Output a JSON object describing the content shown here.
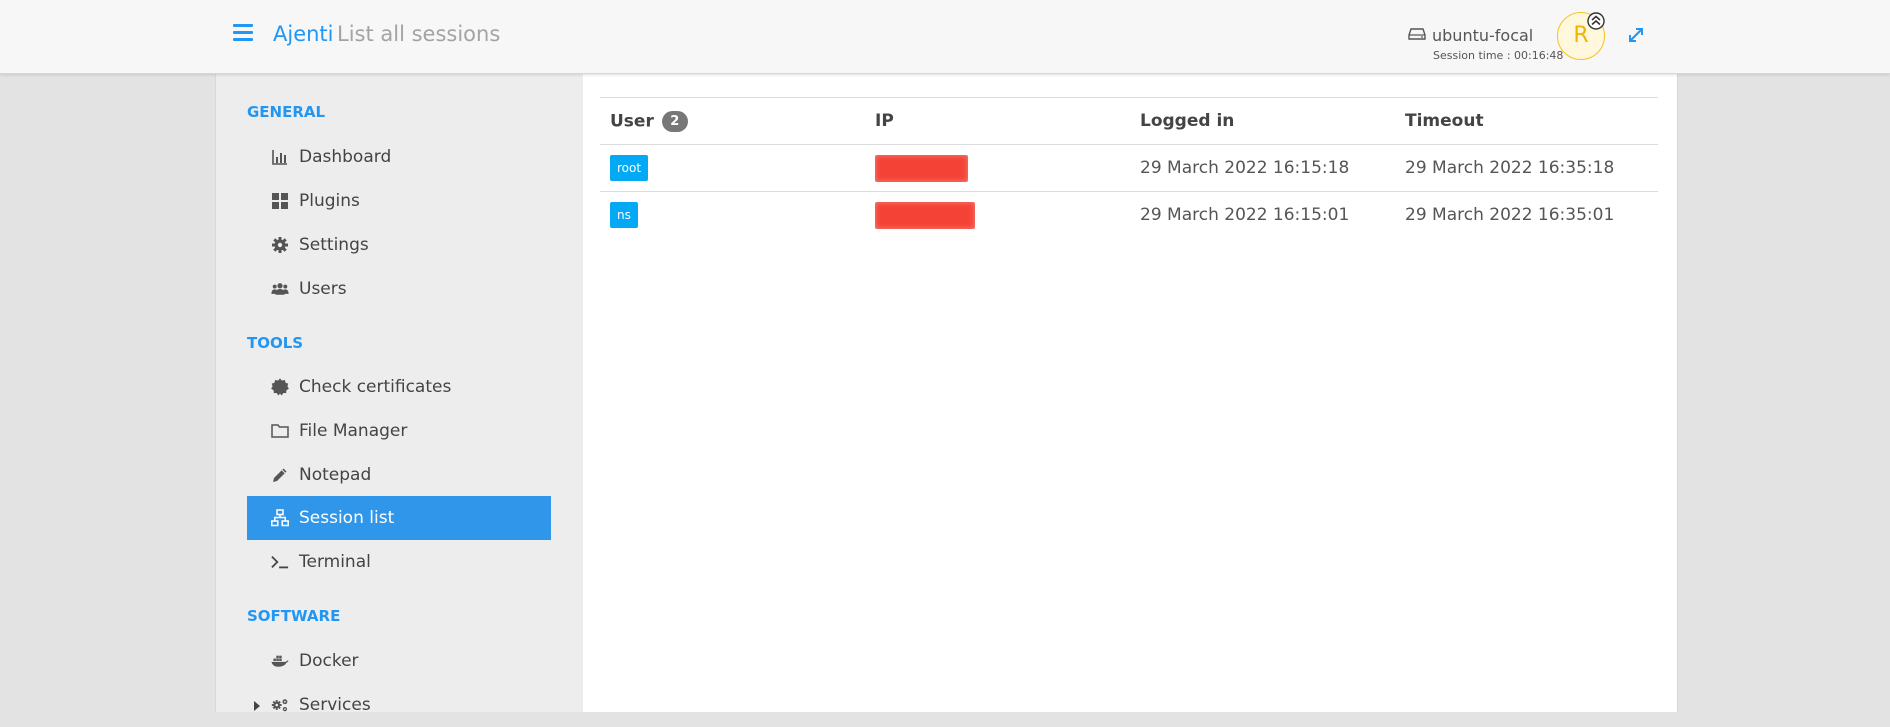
{
  "header": {
    "brand": "Ajenti",
    "page_title": "List all sessions",
    "host_name": "ubuntu-focal",
    "session_time": "Session time : 00:16:48",
    "avatar_letter": "R",
    "icons": {
      "menu": "hamburger-menu-icon",
      "host": "hard-drive-icon",
      "avatar_badge": "double-chevron-up-icon",
      "expand": "expand-arrows-icon"
    }
  },
  "sidebar": {
    "sections": [
      {
        "title": "GENERAL",
        "items": [
          {
            "label": "Dashboard",
            "icon": "bar-chart-icon"
          },
          {
            "label": "Plugins",
            "icon": "grid-icon"
          },
          {
            "label": "Settings",
            "icon": "gear-icon"
          },
          {
            "label": "Users",
            "icon": "users-icon"
          }
        ]
      },
      {
        "title": "TOOLS",
        "items": [
          {
            "label": "Check certificates",
            "icon": "certificate-icon"
          },
          {
            "label": "File Manager",
            "icon": "folder-icon"
          },
          {
            "label": "Notepad",
            "icon": "pencil-icon"
          },
          {
            "label": "Session list",
            "icon": "sitemap-icon",
            "active": true
          },
          {
            "label": "Terminal",
            "icon": "terminal-icon"
          }
        ]
      },
      {
        "title": "SOFTWARE",
        "items": [
          {
            "label": "Docker",
            "icon": "docker-icon"
          },
          {
            "label": "Services",
            "icon": "gears-icon"
          }
        ]
      }
    ]
  },
  "table": {
    "columns": [
      "User",
      "IP",
      "Logged in",
      "Timeout"
    ],
    "user_count": "2",
    "rows": [
      {
        "user": "root",
        "ip": "",
        "logged_in": "29 March 2022 16:15:18",
        "timeout": "29 March 2022 16:35:18"
      },
      {
        "user": "ns",
        "ip": "",
        "logged_in": "29 March 2022 16:15:01",
        "timeout": "29 March 2022 16:35:01"
      }
    ]
  },
  "colors": {
    "accent": "#2196f3",
    "active_item": "#2f96ea",
    "user_tag": "#03a9f4",
    "redaction": "#f44336",
    "avatar": "#f0b400"
  }
}
